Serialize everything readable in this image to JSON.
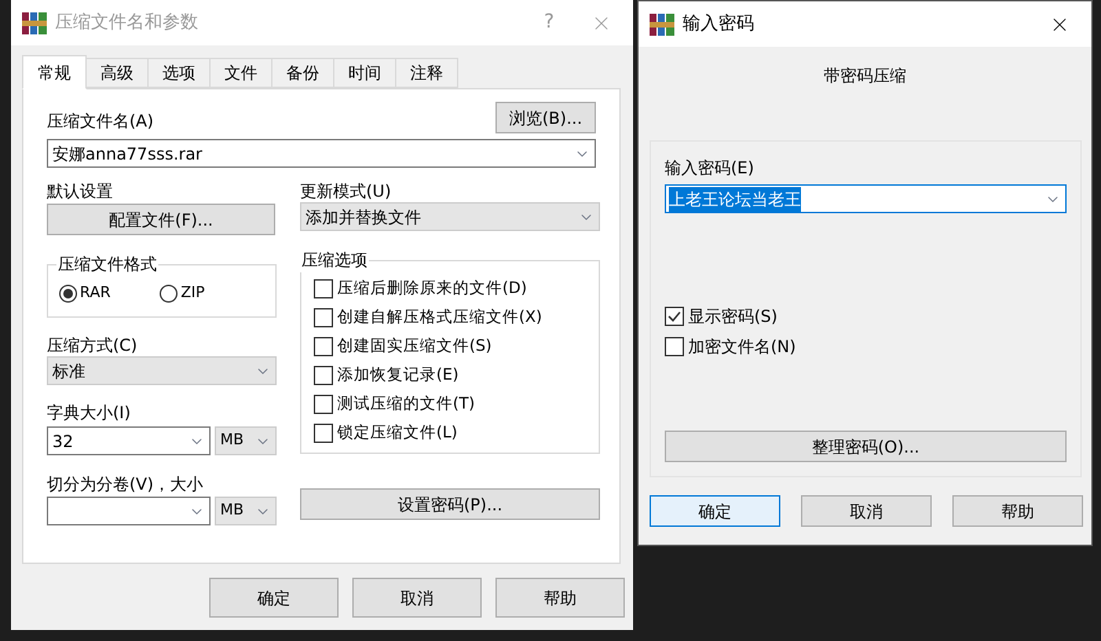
{
  "compress_dialog": {
    "title": "压缩文件名和参数",
    "help_button": "?",
    "tabs": [
      {
        "label": "常规",
        "selected": true
      },
      {
        "label": "高级",
        "selected": false
      },
      {
        "label": "选项",
        "selected": false
      },
      {
        "label": "文件",
        "selected": false
      },
      {
        "label": "备份",
        "selected": false
      },
      {
        "label": "时间",
        "selected": false
      },
      {
        "label": "注释",
        "selected": false
      }
    ],
    "archive_name": {
      "label": "压缩文件名(A)",
      "value": "安娜anna77sss.rar",
      "browse_button": "浏览(B)..."
    },
    "profile": {
      "label": "默认设置",
      "button": "配置文件(F)..."
    },
    "update_mode": {
      "label": "更新模式(U)",
      "value": "添加并替换文件"
    },
    "format": {
      "title": "压缩文件格式",
      "options": [
        {
          "label": "RAR",
          "selected": true
        },
        {
          "label": "ZIP",
          "selected": false
        }
      ]
    },
    "method": {
      "label": "压缩方式(C)",
      "value": "标准"
    },
    "dictionary": {
      "label": "字典大小(I)",
      "value": "32",
      "unit": "MB"
    },
    "split": {
      "label": "切分为分卷(V)，大小",
      "unit": "MB"
    },
    "options": {
      "title": "压缩选项",
      "items": [
        {
          "label": "压缩后删除原来的文件(D)",
          "checked": false
        },
        {
          "label": "创建自解压格式压缩文件(X)",
          "checked": false
        },
        {
          "label": "创建固实压缩文件(S)",
          "checked": false
        },
        {
          "label": "添加恢复记录(E)",
          "checked": false
        },
        {
          "label": "测试压缩的文件(T)",
          "checked": false
        },
        {
          "label": "锁定压缩文件(L)",
          "checked": false
        }
      ]
    },
    "set_password_button": "设置密码(P)...",
    "buttons": [
      {
        "label": "确定",
        "default": false
      },
      {
        "label": "取消",
        "default": false
      },
      {
        "label": "帮助",
        "default": false
      }
    ]
  },
  "password_dialog": {
    "title": "输入密码",
    "heading": "带密码压缩",
    "password": {
      "label": "输入密码(E)",
      "value": "上老王论坛当老王",
      "text_selected": true
    },
    "options": [
      {
        "label": "显示密码(S)",
        "checked": true
      },
      {
        "label": "加密文件名(N)",
        "checked": false
      }
    ],
    "organize_button": "整理密码(O)...",
    "buttons": [
      {
        "label": "确定",
        "default": true
      },
      {
        "label": "取消",
        "default": false
      },
      {
        "label": "帮助",
        "default": false
      }
    ]
  }
}
